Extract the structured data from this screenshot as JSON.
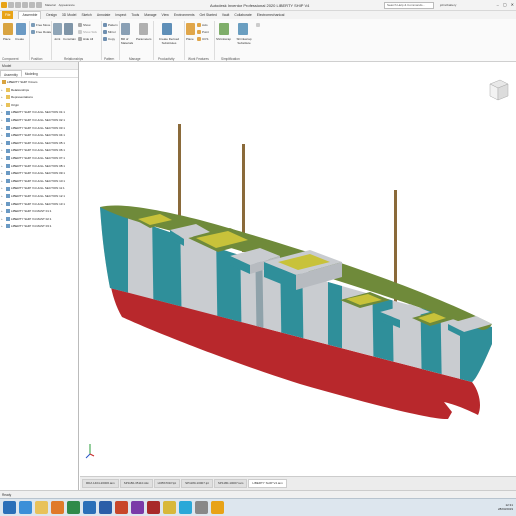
{
  "app": {
    "title": "Autodesk Inventor Professional 2020   LIBERTY SHIP V4",
    "material": "Material",
    "appearance": "Appearance",
    "search_placeholder": "Search Help & Commands...",
    "user": "johncbattery"
  },
  "ribbon_tabs": [
    "File",
    "Assemble",
    "Design",
    "3D Model",
    "Sketch",
    "Annotate",
    "Inspect",
    "Tools",
    "Manage",
    "View",
    "Environments",
    "Get Started",
    "Vault",
    "Collaborate",
    "Electromechanical"
  ],
  "ribbon": {
    "place": "Place",
    "create": "Create",
    "free_move": "Free Move",
    "free_rotate": "Free Rotate",
    "joint": "Joint",
    "constrain": "Constrain",
    "show": "Show",
    "show_sick": "Show Sick",
    "hide_all": "Hide All",
    "pattern": "Pattern",
    "mirror": "Mirror",
    "copy": "Copy",
    "bill_of_materials": "Bill of Materials",
    "parameters": "Parameters",
    "create_derived_substitutes": "Create Derived Substitutes",
    "plane": "Plane",
    "axis": "Axis",
    "point": "Point",
    "ucs": "UCS",
    "shrinkwrap": "Shrinkwrap",
    "shrinkwrap_substitute": "Shrinkwrap Substitute",
    "panels": [
      "Component",
      "Position",
      "Relationships",
      "Pattern",
      "Manage",
      "Productivity",
      "Work Features",
      "Simplification"
    ]
  },
  "browser": {
    "header": "Model",
    "tabs": [
      "Assembly",
      "Modeling"
    ],
    "root": "LIBERTY SHIP V4.iam",
    "folders": [
      "Relationships",
      "Representations",
      "Origin"
    ],
    "items": [
      "LIBERTY SHIP V4 HULL SECTION 01:1",
      "LIBERTY SHIP V4 HULL SECTION 02:1",
      "LIBERTY SHIP V4 HULL SECTION 03:1",
      "LIBERTY SHIP V4 HULL SECTION 04:1",
      "LIBERTY SHIP V4 HULL SECTION 05:1",
      "LIBERTY SHIP V4 HULL SECTION 06:1",
      "LIBERTY SHIP V4 HULL SECTION 07:1",
      "LIBERTY SHIP V4 HULL SECTION 08:1",
      "LIBERTY SHIP V4 HULL SECTION 09:1",
      "LIBERTY SHIP V4 HULL SECTION 10:1",
      "LIBERTY SHIP V4 HULL SECTION 11:1",
      "LIBERTY SHIP V4 HULL SECTION 12:1",
      "LIBERTY SHIP V4 HULL SECTION 13:1",
      "LIBERTY SHIP V4 MAST 01:1",
      "LIBERTY SHIP V4 MAST 02:1",
      "LIBERTY SHIP V4 MAST 03:1"
    ]
  },
  "doc_tabs": [
    "RDA 1404-20006.iam",
    "SP1180-35110.idw",
    "LDBS701P.ipt",
    "SP1180-10007.ipt",
    "SP1180-10007.iam",
    "LIBERTY SHIP V4.iam"
  ],
  "status": "Ready",
  "clock": {
    "time": "12:31",
    "date": "28/03/2019"
  },
  "colors": {
    "hull_red": "#b8282c",
    "camo_teal": "#2f8f9a",
    "camo_grey": "#c9ccd0",
    "deck_green": "#6f8a3a",
    "hatch_yellow": "#c8c23a",
    "mast_brown": "#8a6a3a"
  }
}
